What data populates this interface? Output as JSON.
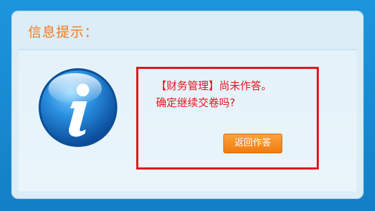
{
  "dialog": {
    "title": "信息提示：",
    "message_line1": "【财务管理】尚未作答。",
    "message_line2": "确定继续交卷吗?",
    "return_button_label": "返回作答",
    "icon": "info-icon"
  },
  "colors": {
    "frame": "#1a8fd6",
    "title": "#f07a1c",
    "message": "#e8141c",
    "highlight_border": "#e0151d",
    "button": "#f58a1f"
  }
}
